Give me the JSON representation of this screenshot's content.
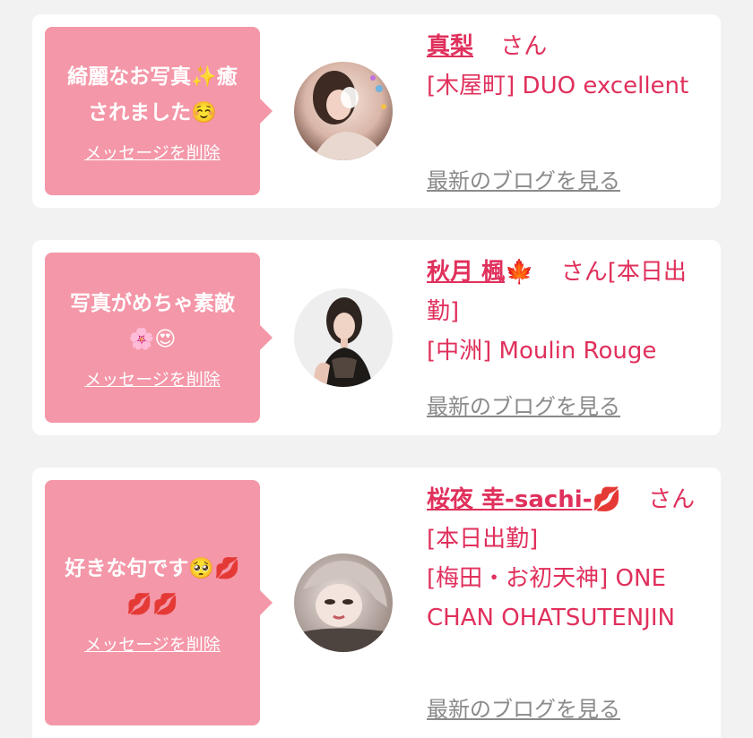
{
  "cards": [
    {
      "message": "綺麗なお写真✨癒されました☺️",
      "delete_label": "メッセージを削除",
      "name": "真梨",
      "name_suffix": "",
      "honorific": "さん",
      "shop": "[木屋町] DUO excellent",
      "blog_label": "最新のブログを見る"
    },
    {
      "message": "写真がめちゃ素敵🌸😍",
      "delete_label": "メッセージを削除",
      "name": "秋月 楓",
      "name_suffix": "🍁",
      "honorific": "さん[本日出勤]",
      "shop": "[中洲] Moulin Rouge",
      "blog_label": "最新のブログを見る"
    },
    {
      "message": "好きな句です🥺💋💋💋",
      "delete_label": "メッセージを削除",
      "name": "桜夜 幸-sachi-",
      "name_suffix": "💋",
      "honorific": "さん[本日出勤]",
      "shop": "[梅田・お初天神] ONE CHAN OHATSUTENJIN",
      "blog_label": "最新のブログを見る"
    }
  ],
  "colors": {
    "background": "#f2f2f2",
    "bubble": "#f497a8",
    "accent": "#e0305c",
    "link_gray": "#8a8a8a"
  },
  "icons": [
    "sparkles-icon",
    "relieved-face-icon",
    "cherry-blossom-icon",
    "heart-eyes-icon",
    "maple-leaf-icon",
    "pleading-face-icon",
    "kiss-mark-icon"
  ]
}
